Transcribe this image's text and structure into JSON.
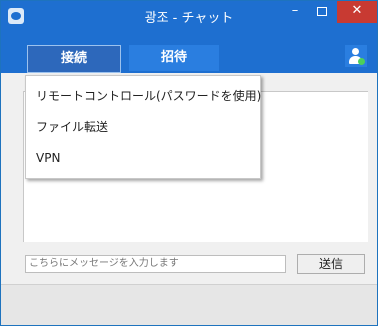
{
  "window": {
    "title": "광조 - チャット",
    "min_label": "–",
    "close_label": "✕"
  },
  "toolbar": {
    "tabs": [
      {
        "label": "接続"
      },
      {
        "label": "招待"
      }
    ],
    "user_icon": "user-presence-icon"
  },
  "menu": {
    "items": [
      {
        "label": "リモートコントロール(パスワードを使用)"
      },
      {
        "label": "ファイル転送"
      },
      {
        "label": "VPN"
      }
    ]
  },
  "composer": {
    "placeholder": "こちらにメッセージを入力します",
    "send_label": "送信"
  },
  "colors": {
    "accent": "#1e6fd0",
    "close": "#c83a32",
    "online": "#4cd05a"
  }
}
